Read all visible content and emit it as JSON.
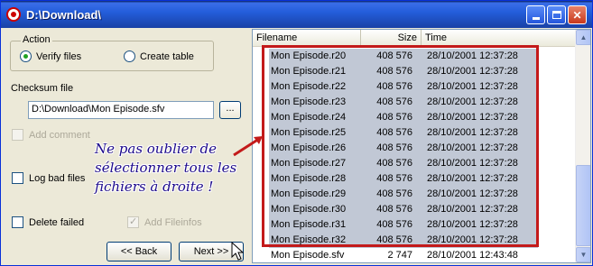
{
  "window": {
    "title": "D:\\Download\\",
    "icon": "app-disc-icon"
  },
  "left": {
    "action_group_label": "Action",
    "radio_verify_label": "Verify files",
    "radio_create_label": "Create table",
    "checksum_label": "Checksum file",
    "checksum_value": "D:\\Download\\Mon Episode.sfv",
    "browse_label": "...",
    "add_comment_label": "Add comment",
    "log_bad_label": "Log bad files",
    "delete_failed_label": "Delete failed",
    "add_fileinfos_label": "Add Fileinfos",
    "back_label": "<< Back",
    "next_label": "Next >>"
  },
  "annotation": {
    "lines": [
      "Ne pas oublier de",
      "sélectionner tous les",
      "fichiers à droite !"
    ]
  },
  "list": {
    "columns": [
      "Filename",
      "Size",
      "Time"
    ],
    "rows": [
      {
        "name": "Mon Episode.r20",
        "size": "408 576",
        "time": "28/10/2001 12:37:28",
        "selected": true
      },
      {
        "name": "Mon Episode.r21",
        "size": "408 576",
        "time": "28/10/2001 12:37:28",
        "selected": true
      },
      {
        "name": "Mon Episode.r22",
        "size": "408 576",
        "time": "28/10/2001 12:37:28",
        "selected": true
      },
      {
        "name": "Mon Episode.r23",
        "size": "408 576",
        "time": "28/10/2001 12:37:28",
        "selected": true
      },
      {
        "name": "Mon Episode.r24",
        "size": "408 576",
        "time": "28/10/2001 12:37:28",
        "selected": true
      },
      {
        "name": "Mon Episode.r25",
        "size": "408 576",
        "time": "28/10/2001 12:37:28",
        "selected": true
      },
      {
        "name": "Mon Episode.r26",
        "size": "408 576",
        "time": "28/10/2001 12:37:28",
        "selected": true
      },
      {
        "name": "Mon Episode.r27",
        "size": "408 576",
        "time": "28/10/2001 12:37:28",
        "selected": true
      },
      {
        "name": "Mon Episode.r28",
        "size": "408 576",
        "time": "28/10/2001 12:37:28",
        "selected": true
      },
      {
        "name": "Mon Episode.r29",
        "size": "408 576",
        "time": "28/10/2001 12:37:28",
        "selected": true
      },
      {
        "name": "Mon Episode.r30",
        "size": "408 576",
        "time": "28/10/2001 12:37:28",
        "selected": true
      },
      {
        "name": "Mon Episode.r31",
        "size": "408 576",
        "time": "28/10/2001 12:37:28",
        "selected": true
      },
      {
        "name": "Mon Episode.r32",
        "size": "408 576",
        "time": "28/10/2001 12:37:28",
        "selected": true
      },
      {
        "name": "Mon Episode.sfv",
        "size": "2 747",
        "time": "28/10/2001 12:43:48",
        "selected": false
      }
    ]
  },
  "colors": {
    "highlight": "#c31a1a",
    "annotation_text": "#1d0a8c",
    "selection": "#c1c8d5"
  }
}
